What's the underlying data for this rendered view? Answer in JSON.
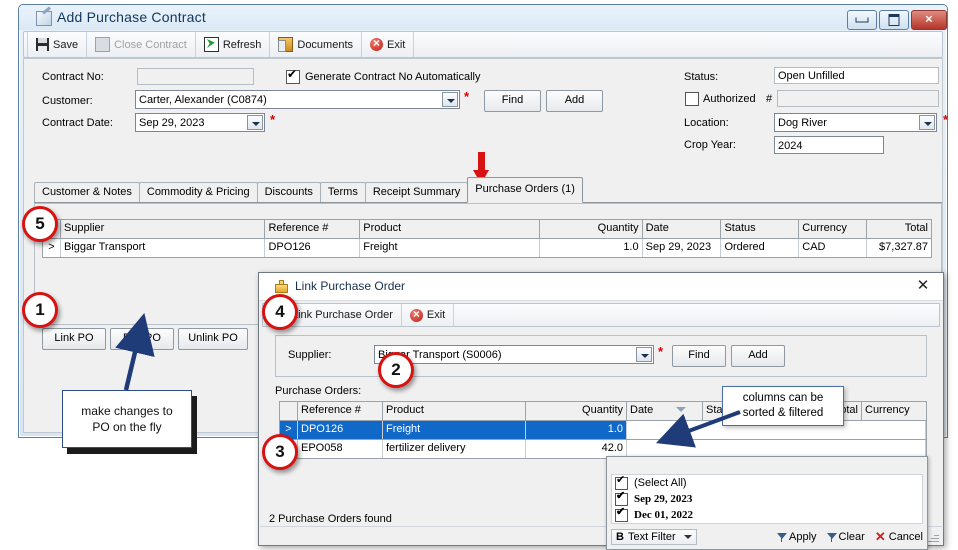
{
  "window": {
    "title": "Add Purchase Contract",
    "controls": {
      "minimize": "minimize-button",
      "maximize": "maximize-button",
      "close": "close-button"
    }
  },
  "toolbar": {
    "items": [
      {
        "label": "Save",
        "icon": "save-icon",
        "enabled": true
      },
      {
        "label": "Close Contract",
        "icon": "close-contract-icon",
        "enabled": false
      },
      {
        "label": "Refresh",
        "icon": "refresh-icon",
        "enabled": true
      },
      {
        "label": "Documents",
        "icon": "documents-icon",
        "enabled": true
      },
      {
        "label": "Exit",
        "icon": "exit-icon",
        "enabled": true
      }
    ]
  },
  "form": {
    "contract_no_label": "Contract No:",
    "contract_no_value": "",
    "generate_checkbox_label": "Generate Contract No Automatically",
    "generate_checked": true,
    "customer_label": "Customer:",
    "customer_value": "Carter, Alexander (C0874)",
    "find_label": "Find",
    "add_label": "Add",
    "contract_date_label": "Contract Date:",
    "contract_date_value": "Sep 29, 2023",
    "status_label": "Status:",
    "status_value": "Open Unfilled",
    "authorized_label": "Authorized",
    "authorized_checked": false,
    "authorized_hash": "#",
    "authorized_value": "",
    "location_label": "Location:",
    "location_value": "Dog River",
    "crop_year_label": "Crop Year:",
    "crop_year_value": "2024"
  },
  "tabs": [
    {
      "label": "Customer & Notes",
      "active": false
    },
    {
      "label": "Commodity & Pricing",
      "active": false
    },
    {
      "label": "Discounts",
      "active": false
    },
    {
      "label": "Terms",
      "active": false
    },
    {
      "label": "Receipt Summary",
      "active": false
    },
    {
      "label": "Purchase Orders (1)",
      "active": true
    }
  ],
  "main_grid": {
    "columns": [
      "Supplier",
      "Reference #",
      "Product",
      "Quantity",
      "Date",
      "Status",
      "Currency",
      "Total"
    ],
    "row_indicator": ">",
    "rows": [
      {
        "supplier": "Biggar Transport",
        "reference": "DPO126",
        "product": "Freight",
        "quantity": "1.0",
        "date": "Sep 29, 2023",
        "status": "Ordered",
        "currency": "CAD",
        "total": "$7,327.87"
      }
    ]
  },
  "po_buttons": [
    {
      "label": "Link PO"
    },
    {
      "label": "Edit PO"
    },
    {
      "label": "Unlink PO"
    }
  ],
  "dialog": {
    "title": "Link Purchase Order",
    "close_label": "✕",
    "toolbar": [
      {
        "label": "Link Purchase Order",
        "icon": "link-po-icon"
      },
      {
        "label": "Exit",
        "icon": "exit-icon"
      }
    ],
    "supplier_label": "Supplier:",
    "supplier_value": "Biggar Transport (S0006)",
    "find_label": "Find",
    "add_label": "Add",
    "grid_label": "Purchase Orders:",
    "columns": [
      "Reference #",
      "Product",
      "Quantity",
      "Date",
      "Status",
      "Total",
      "Currency"
    ],
    "sorted_column": "Date",
    "rows": [
      {
        "reference": "DPO126",
        "product": "Freight",
        "quantity": "1.0",
        "selected": true
      },
      {
        "reference": "EPO058",
        "product": "fertilizer delivery",
        "quantity": "42.0",
        "selected": false
      }
    ],
    "status_text": "2 Purchase Orders found"
  },
  "filter_popup": {
    "items": [
      {
        "label": "(Select All)",
        "checked": true,
        "bold": false
      },
      {
        "label": "Sep 29, 2023",
        "checked": true,
        "bold": true
      },
      {
        "label": "Dec 01, 2022",
        "checked": true,
        "bold": true
      }
    ],
    "text_filter_label": "Text Filter",
    "text_filter_prefix": "B",
    "apply_label": "Apply",
    "clear_label": "Clear",
    "cancel_label": "Cancel"
  },
  "annotations": {
    "badges": [
      "1",
      "2",
      "3",
      "4",
      "5"
    ],
    "callout_edit_po": "make changes to\nPO on the fly",
    "callout_edit_po_line1": "make changes to",
    "callout_edit_po_line2": "PO on the fly",
    "callout_columns_line1": "columns can be",
    "callout_columns_line2": "sorted & filtered"
  },
  "colors": {
    "accent_red": "#d81111",
    "selection_blue": "#1069c9",
    "arrow_navy": "#1f3c78",
    "window_border": "#5a7fa3"
  }
}
